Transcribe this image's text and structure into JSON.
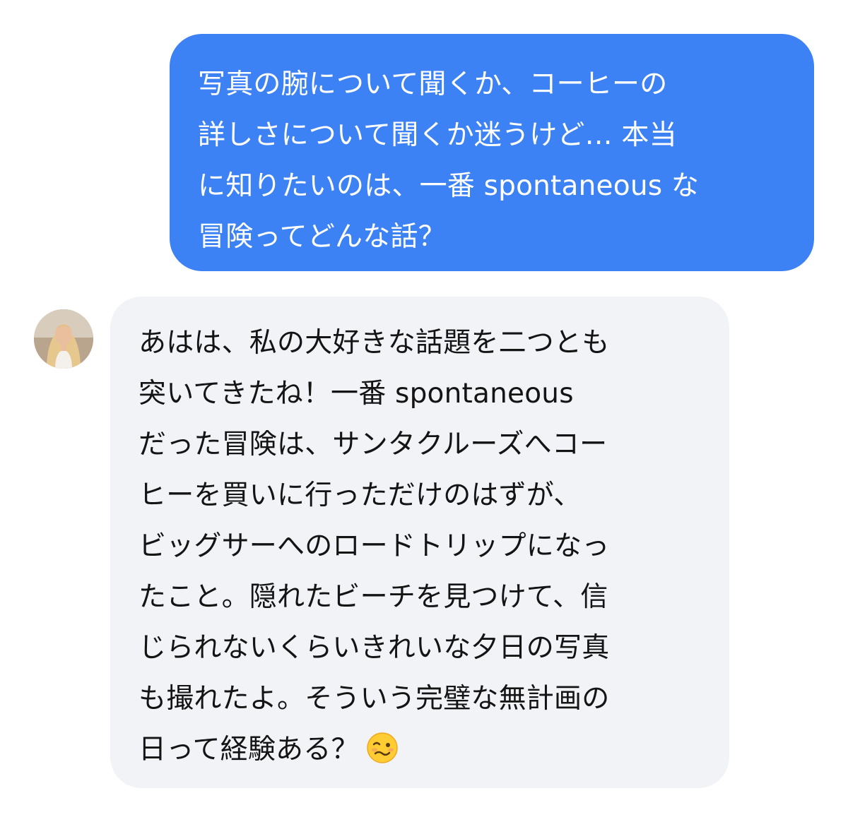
{
  "conversation": {
    "user_message": {
      "lines": [
        "写真の腕について聞くか、コーヒーの",
        "詳しさについて聞くか迷うけど… 本当",
        "に知りたいのは、一番 spontaneous な",
        "冒険ってどんな話？"
      ]
    },
    "reply_message": {
      "lines": [
        "あはは、私の大好きな話題を二つとも",
        "突いてきたね！一番 spontaneous",
        "だった冒険は、サンタクルーズへコー",
        "ヒーを買いに行っただけのはずが、",
        "ビッグサーへのロードトリップになっ",
        "たこと。隠れたビーチを見つけて、信",
        "じられないくらいきれいな夕日の写真",
        "も撮れたよ。そういう完璧な無計画の",
        "日って経験ある？"
      ],
      "emoji": "woozy-face-emoji"
    },
    "avatar": {
      "icon": "profile-photo-woman"
    }
  },
  "colors": {
    "outgoing_bubble": "#3d82f5",
    "incoming_bubble": "#f2f3f7",
    "outgoing_text": "#ffffff",
    "incoming_text": "#141414"
  }
}
